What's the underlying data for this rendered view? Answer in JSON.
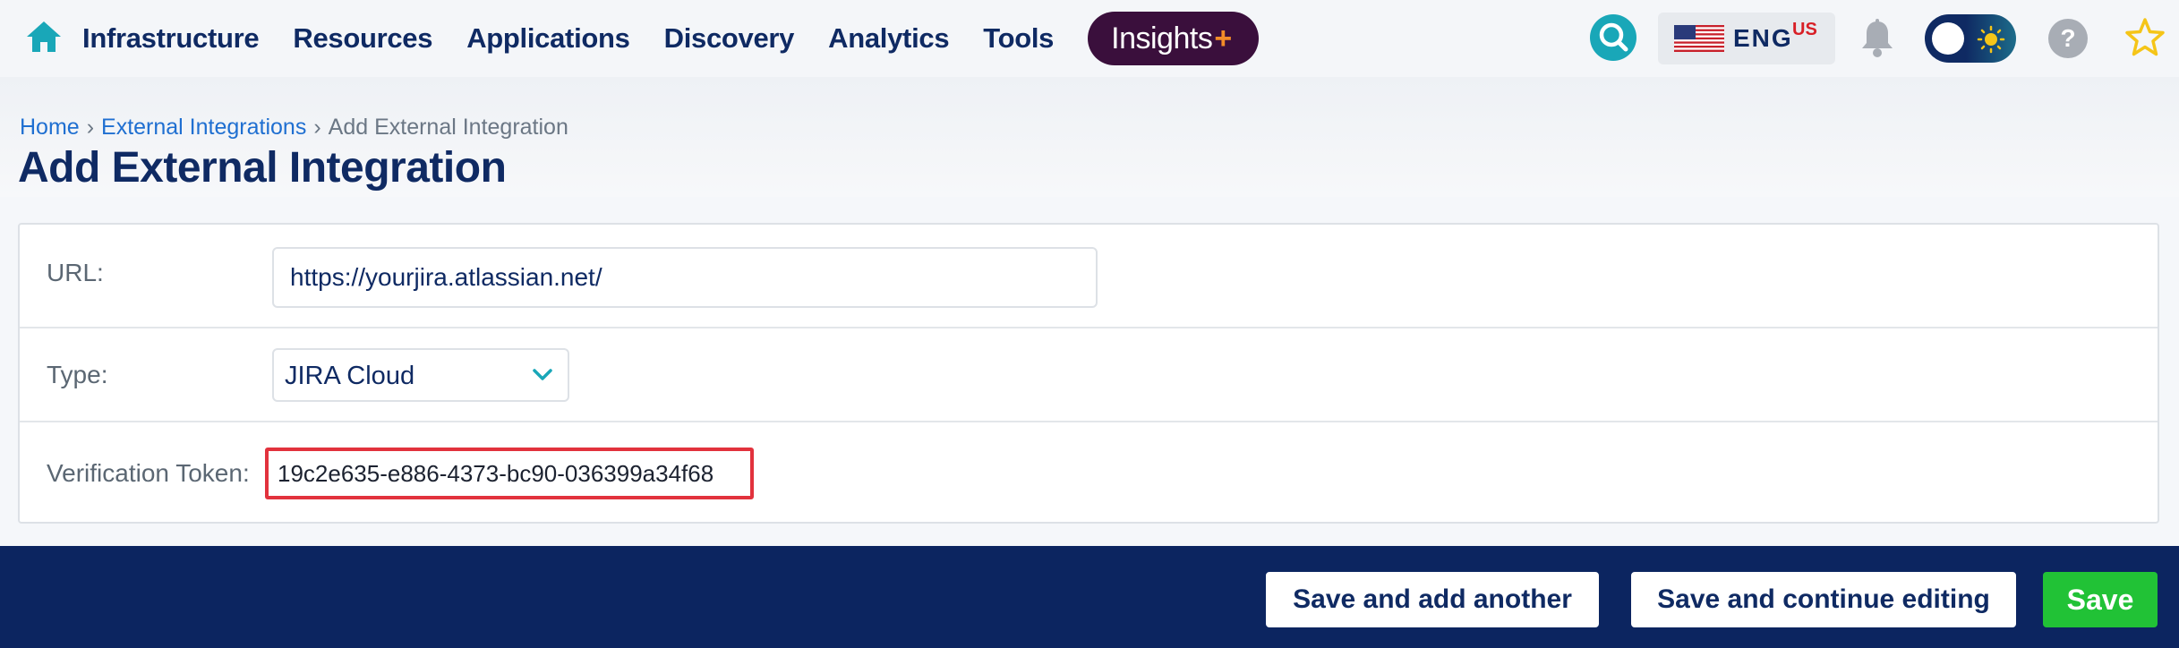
{
  "nav": {
    "items": [
      {
        "label": "Infrastructure"
      },
      {
        "label": "Resources"
      },
      {
        "label": "Applications"
      },
      {
        "label": "Discovery"
      },
      {
        "label": "Analytics"
      },
      {
        "label": "Tools"
      }
    ],
    "insights": {
      "label": "Insights",
      "plus": "+"
    },
    "icons": [
      "home-icon",
      "search-icon",
      "us-flag-icon",
      "bell-icon",
      "theme-toggle",
      "help-icon",
      "star-icon"
    ],
    "language": {
      "code": "ENG",
      "region": "US"
    },
    "help_glyph": "?"
  },
  "breadcrumb": {
    "home": "Home",
    "separator": "›",
    "parent": "External Integrations",
    "current": "Add External Integration"
  },
  "page": {
    "title": "Add External Integration"
  },
  "form": {
    "url": {
      "label": "URL:",
      "value": "https://yourjira.atlassian.net/"
    },
    "type": {
      "label": "Type:",
      "selected": "JIRA Cloud"
    },
    "token": {
      "label": "Verification Token:",
      "value": "19c2e635-e886-4373-bc90-036399a34f68"
    }
  },
  "actions": {
    "save_add_another": "Save and add another",
    "save_continue": "Save and continue editing",
    "save": "Save"
  },
  "colors": {
    "nav_text": "#0f2a63",
    "insights_bg": "#3a0f3c",
    "insights_plus": "#f28c28",
    "search_bg": "#19a7b8",
    "link": "#1f6fd1",
    "highlight_border": "#e2323d",
    "action_bar": "#0c2560",
    "save_button": "#21c236"
  }
}
